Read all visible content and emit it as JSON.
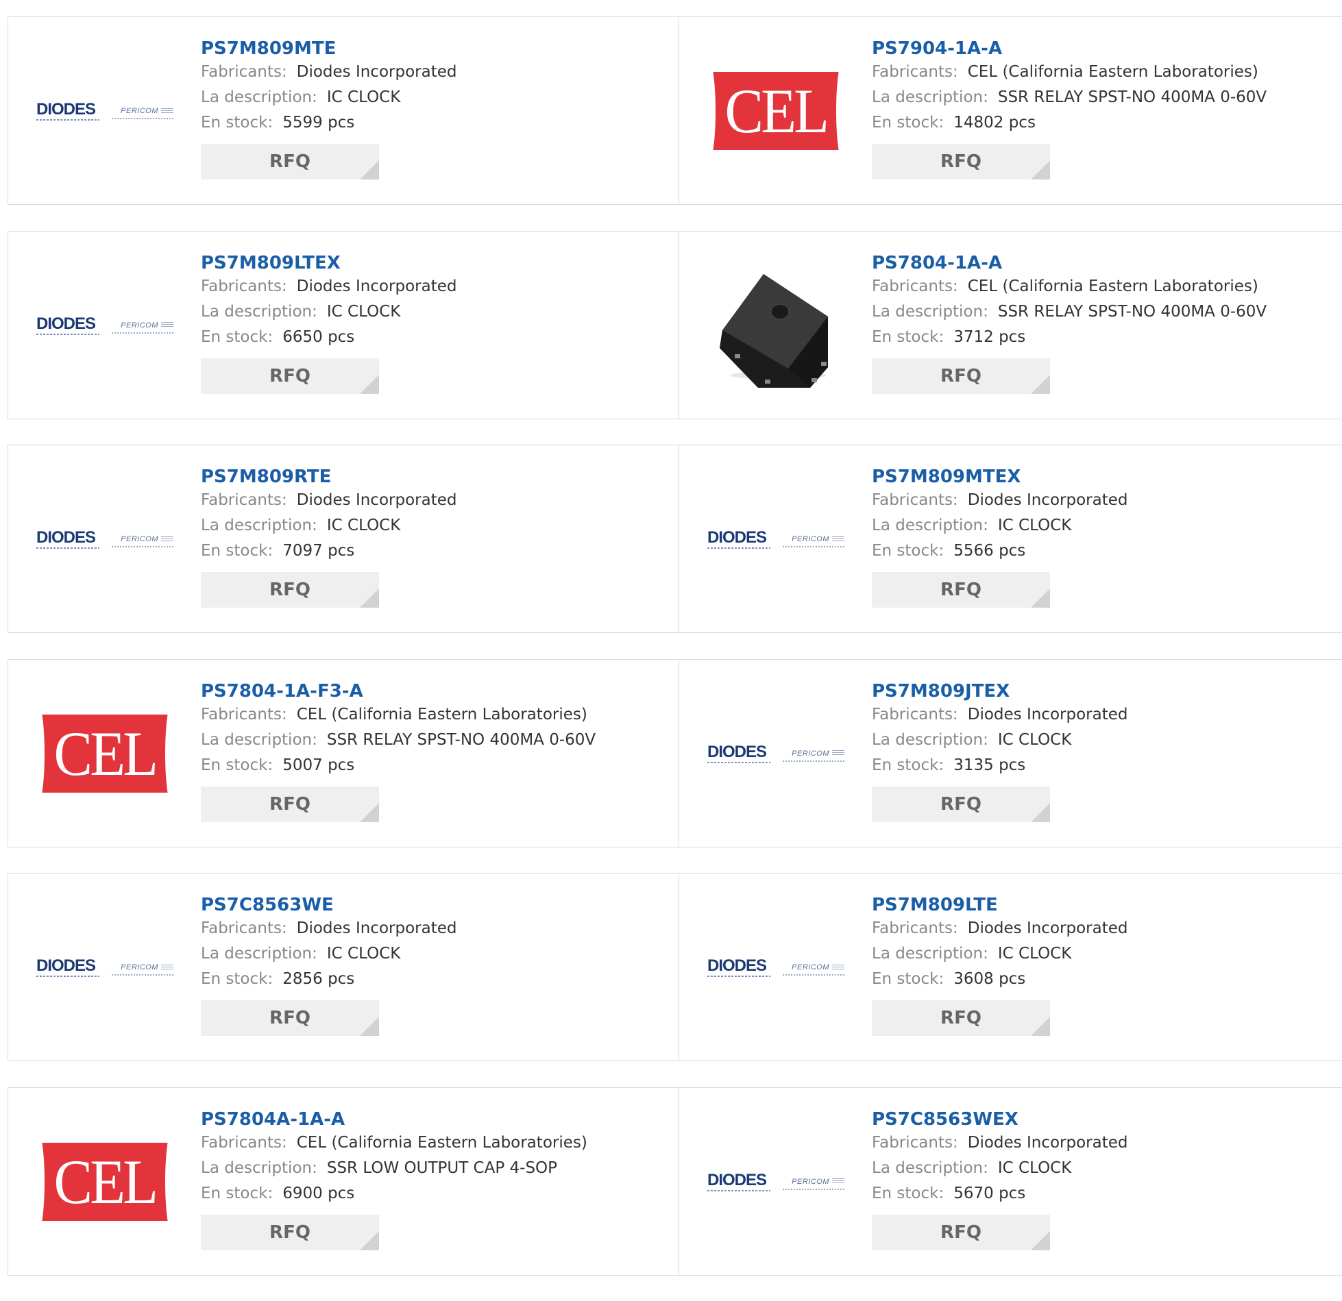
{
  "labels": {
    "manufacturer": "Fabricants:",
    "description": "La description:",
    "stock": "En stock:",
    "rfq": "RFQ"
  },
  "logos": {
    "diodes_main": "DIODES",
    "diodes_sub": "PERICOM",
    "cel": "CEL"
  },
  "products": [
    {
      "pn": "PS7M809MTE",
      "mfr": "Diodes Incorporated",
      "desc": "IC CLOCK",
      "stock": "5599 pcs",
      "logo": "diodes"
    },
    {
      "pn": "PS7904-1A-A",
      "mfr": "CEL (California Eastern Laboratories)",
      "desc": "SSR RELAY SPST-NO 400MA 0-60V",
      "stock": "14802 pcs",
      "logo": "cel"
    },
    {
      "pn": "PS7M809LTEX",
      "mfr": "Diodes Incorporated",
      "desc": "IC CLOCK",
      "stock": "6650 pcs",
      "logo": "diodes"
    },
    {
      "pn": "PS7804-1A-A",
      "mfr": "CEL (California Eastern Laboratories)",
      "desc": "SSR RELAY SPST-NO 400MA 0-60V",
      "stock": "3712 pcs",
      "logo": "chip"
    },
    {
      "pn": "PS7M809RTE",
      "mfr": "Diodes Incorporated",
      "desc": "IC CLOCK",
      "stock": "7097 pcs",
      "logo": "diodes"
    },
    {
      "pn": "PS7M809MTEX",
      "mfr": "Diodes Incorporated",
      "desc": "IC CLOCK",
      "stock": "5566 pcs",
      "logo": "diodes"
    },
    {
      "pn": "PS7804-1A-F3-A",
      "mfr": "CEL (California Eastern Laboratories)",
      "desc": "SSR RELAY SPST-NO 400MA 0-60V",
      "stock": "5007 pcs",
      "logo": "cel"
    },
    {
      "pn": "PS7M809JTEX",
      "mfr": "Diodes Incorporated",
      "desc": "IC CLOCK",
      "stock": "3135 pcs",
      "logo": "diodes"
    },
    {
      "pn": "PS7C8563WE",
      "mfr": "Diodes Incorporated",
      "desc": "IC CLOCK",
      "stock": "2856 pcs",
      "logo": "diodes"
    },
    {
      "pn": "PS7M809LTE",
      "mfr": "Diodes Incorporated",
      "desc": "IC CLOCK",
      "stock": "3608 pcs",
      "logo": "diodes"
    },
    {
      "pn": "PS7804A-1A-A",
      "mfr": "CEL (California Eastern Laboratories)",
      "desc": "SSR LOW OUTPUT CAP 4-SOP",
      "stock": "6900 pcs",
      "logo": "cel"
    },
    {
      "pn": "PS7C8563WEX",
      "mfr": "Diodes Incorporated",
      "desc": "IC CLOCK",
      "stock": "5670 pcs",
      "logo": "diodes"
    }
  ]
}
